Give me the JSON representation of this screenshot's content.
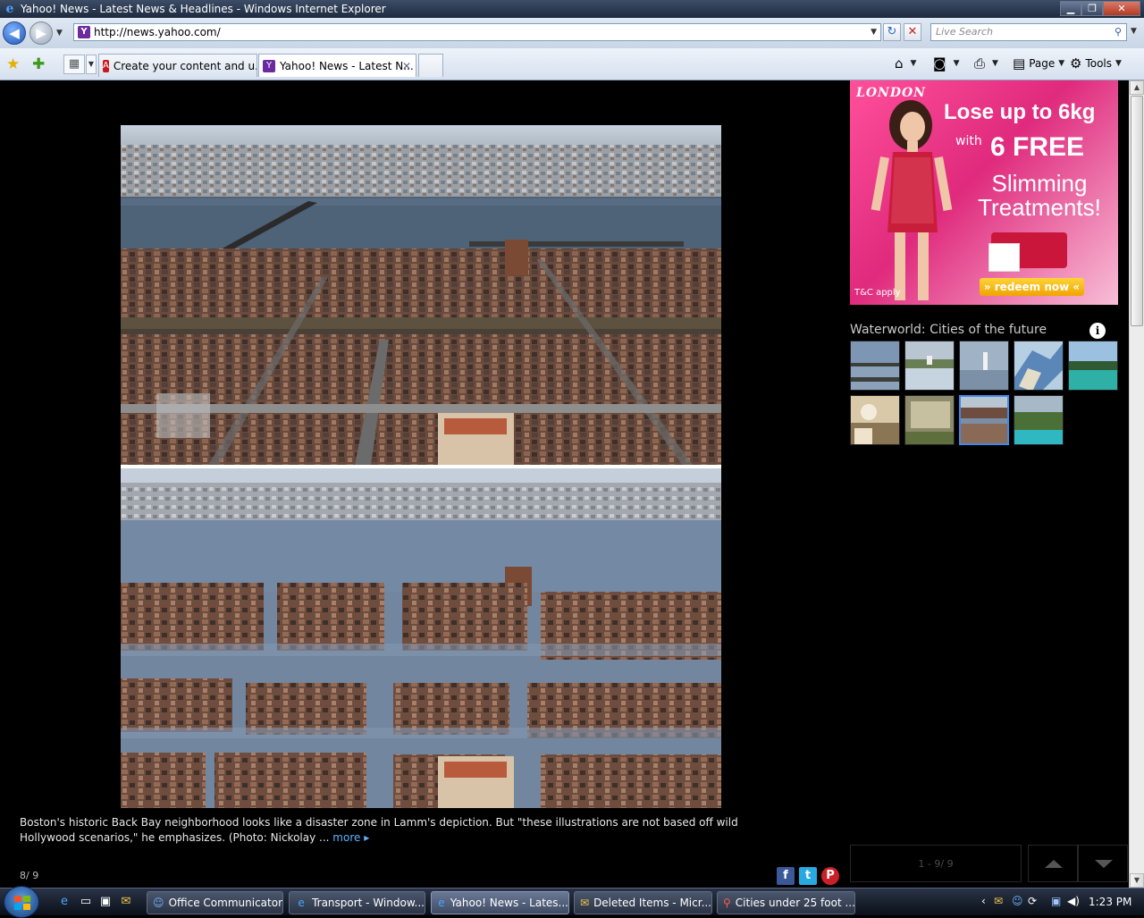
{
  "window": {
    "title": "Yahoo! News - Latest News & Headlines - Windows Internet Explorer",
    "controls": {
      "minimize": "▁",
      "maximize": "❐",
      "close": "✕"
    }
  },
  "addressbar": {
    "url": "http://news.yahoo.com/",
    "search_placeholder": "Live Search"
  },
  "tabs": [
    {
      "label": "Create your content and u...",
      "icon": "adobe-icon",
      "active": false
    },
    {
      "label": "Yahoo! News - Latest N...",
      "icon": "yahoo-icon",
      "active": true
    }
  ],
  "commands": {
    "page": "Page",
    "tools": "Tools"
  },
  "ad": {
    "brand": "LONDON",
    "line1": "Lose up to 6kg",
    "line2": "with",
    "line3": "6 FREE",
    "line4": "Slimming Treatments!",
    "tc": "T&C apply",
    "cta": "» redeem now «",
    "colors": {
      "pink": "#e02a7d",
      "cta": "#f0a400"
    }
  },
  "gallery": {
    "title": "Waterworld: Cities of the future",
    "info_icon": "i",
    "thumbnails_count": 9,
    "selected_index": 7,
    "caption": "Boston's historic Back Bay neighborhood looks like a disaster zone in Lamm's depiction. But \"these illustrations are not based off wild Hollywood scenarios,\" he emphasizes. (Photo: Nickolay ...",
    "more": "more",
    "counter": "8/ 9",
    "range": "1 - 9/ 9"
  },
  "share": {
    "facebook": "f",
    "twitter": "t",
    "pinterest": "P"
  },
  "taskbar": {
    "tasks": [
      {
        "label": "Office Communicator",
        "icon": "communicator-icon"
      },
      {
        "label": "Transport - Window...",
        "icon": "ie-icon"
      },
      {
        "label": "Yahoo! News - Lates...",
        "icon": "ie-icon",
        "active": true
      },
      {
        "label": "Deleted Items - Micr...",
        "icon": "outlook-icon"
      },
      {
        "label": "Cities under 25 foot ...",
        "icon": "pdf-icon"
      }
    ],
    "clock": "1:23 PM"
  }
}
